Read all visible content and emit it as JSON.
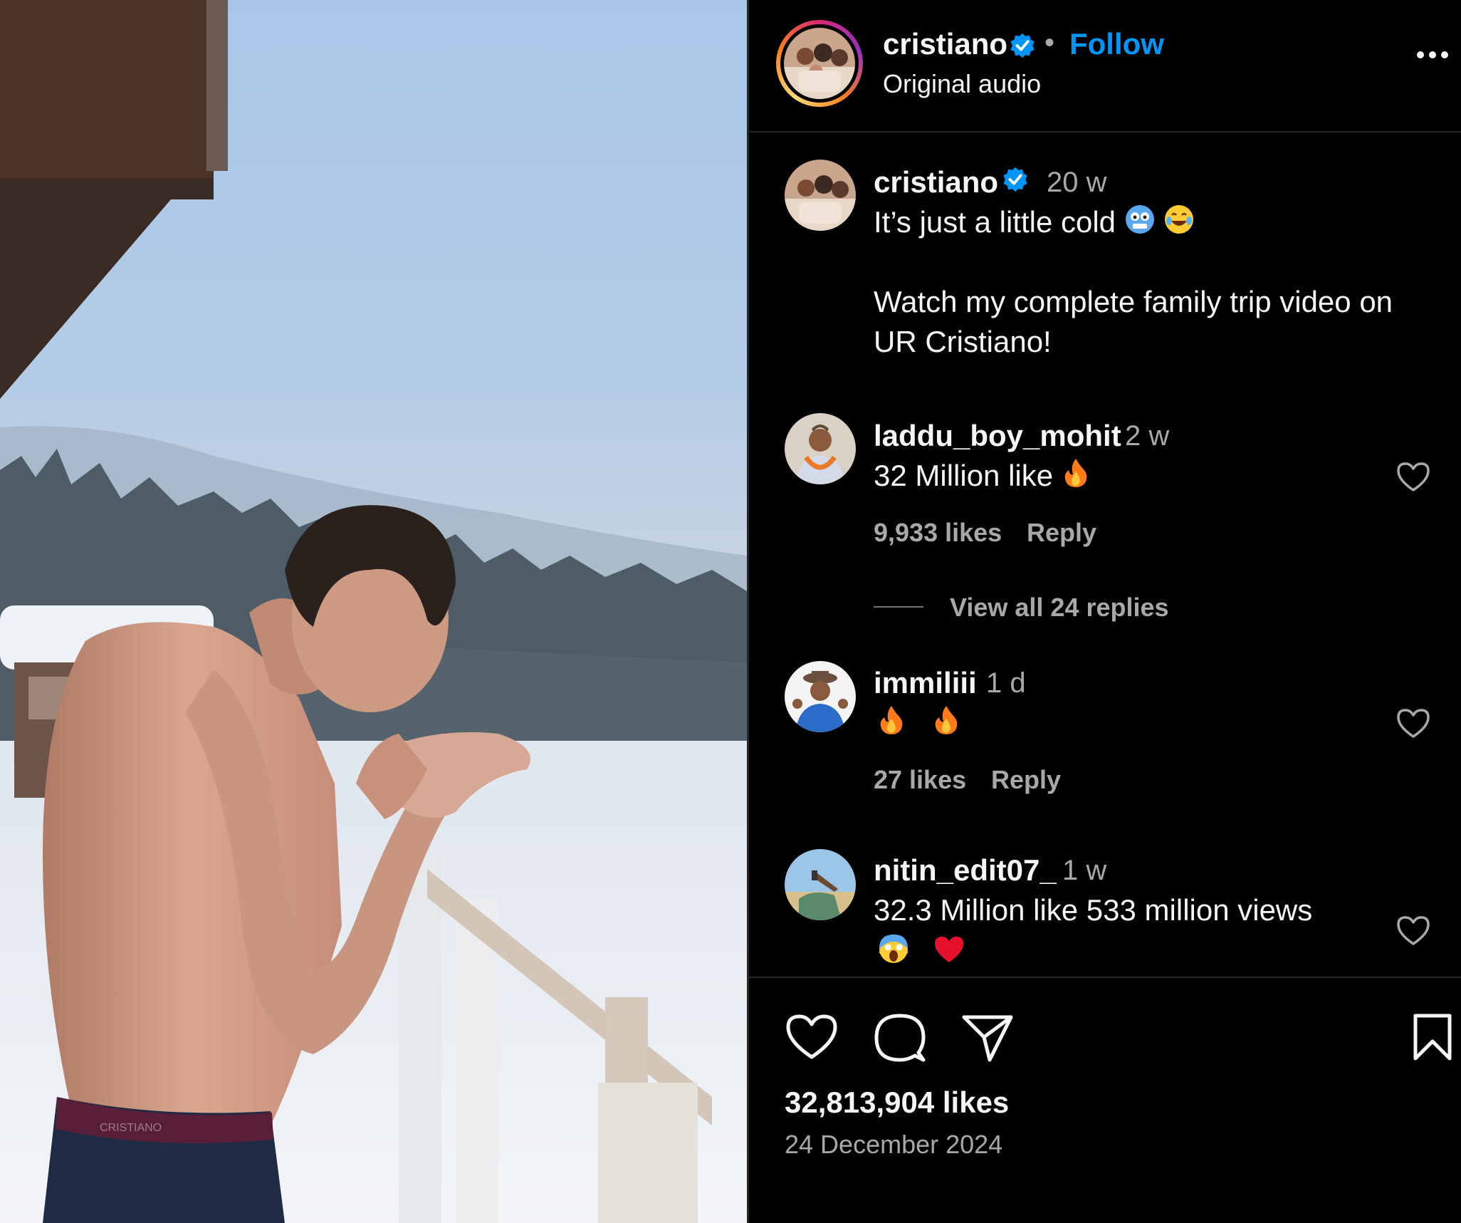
{
  "media": {
    "description_icon": "reel-video",
    "waistband_text": "CRISTIANO"
  },
  "header": {
    "username": "cristiano",
    "separator": "•",
    "follow_label": "Follow",
    "audio_label": "Original audio",
    "more_icon": "more-horizontal-icon"
  },
  "caption": {
    "username": "cristiano",
    "time": "20 w",
    "line1": "It’s just a little cold",
    "line2": "Watch my complete family trip video on",
    "line3": "UR Cristiano!"
  },
  "comments": [
    {
      "username": "laddu_boy_mohit",
      "time": "2 w",
      "text": "32 Million like",
      "likes": "9,933 likes",
      "reply_label": "Reply",
      "view_replies": "View all 24 replies"
    },
    {
      "username": "immiliii",
      "time": "1 d",
      "text": "",
      "likes": "27 likes",
      "reply_label": "Reply"
    },
    {
      "username": "nitin_edit07_",
      "time": "1 w",
      "text": "32.3 Million like 533 million views",
      "likes": "",
      "reply_label": ""
    }
  ],
  "footer": {
    "likes": "32,813,904 likes",
    "date": "24 December 2024"
  },
  "colors": {
    "accent": "#0095f6",
    "background": "#000000",
    "text": "#f5f5f5",
    "muted": "#a8a8a8",
    "divider": "#262626"
  }
}
